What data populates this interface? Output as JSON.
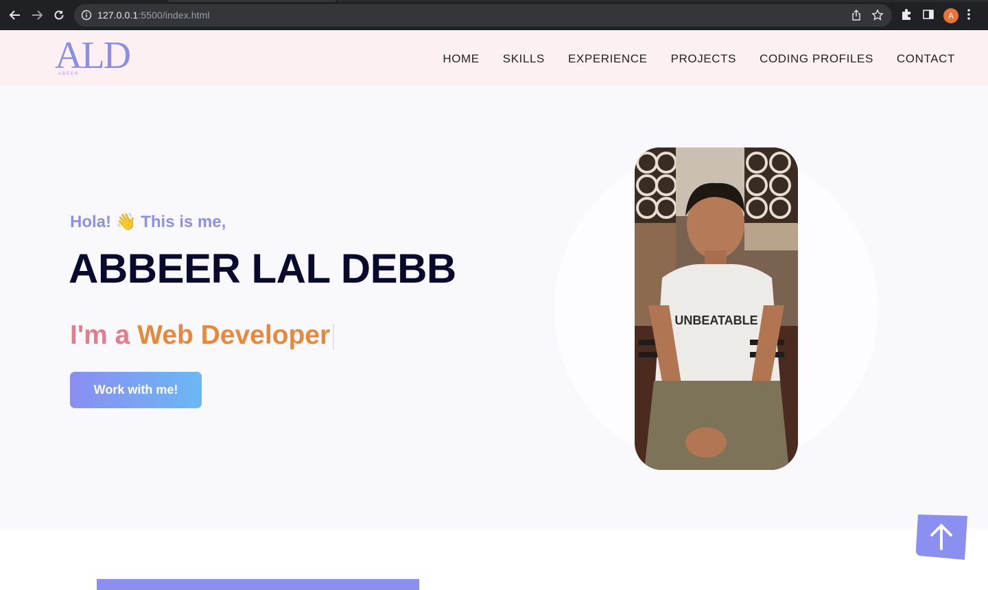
{
  "browser": {
    "url_host": "127.0.0.1",
    "url_rest": ":5500/index.html",
    "profile_initial": "A"
  },
  "header": {
    "logo": "ALD",
    "logo_sub": "ABEER",
    "nav": [
      "HOME",
      "SKILLS",
      "EXPERIENCE",
      "PROJECTS",
      "CODING PROFILES",
      "CONTACT"
    ]
  },
  "hero": {
    "greeting": "Hola! 👋 This is me,",
    "name": "ABBEER LAL DEBB",
    "role_prefix": "I'm a ",
    "role_main": "Web Developer",
    "cta_label": "Work with me!",
    "photo_shirt_text": "UNBEATABLE"
  },
  "colors": {
    "accent": "#8a8ff0",
    "role_prefix": "#e57c8e",
    "role_main": "#e8883a",
    "header_bg": "#fdf0f3",
    "name": "#08092d"
  }
}
